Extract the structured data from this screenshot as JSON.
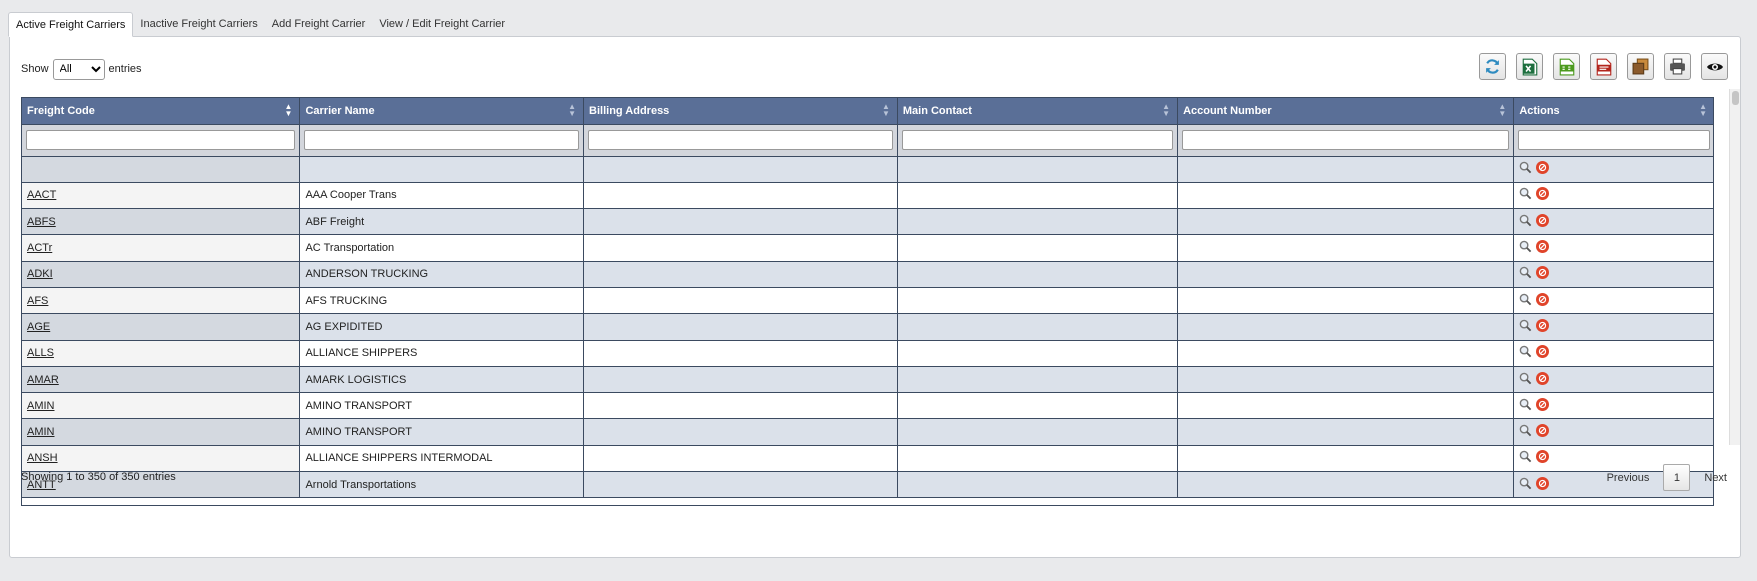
{
  "tabs": [
    {
      "label": "Active Freight Carriers"
    },
    {
      "label": "Inactive Freight Carriers"
    },
    {
      "label": "Add Freight Carrier"
    },
    {
      "label": "View / Edit Freight Carrier"
    }
  ],
  "length_control": {
    "show_label": "Show",
    "selected": "All",
    "entries_label": "entries"
  },
  "toolbar": [
    {
      "icon": "refresh-icon",
      "label": "Refresh"
    },
    {
      "icon": "excel-icon",
      "label": "Excel"
    },
    {
      "icon": "csv-icon",
      "label": "CSV"
    },
    {
      "icon": "pdf-icon",
      "label": "PDF"
    },
    {
      "icon": "copy-icon",
      "label": "Copy"
    },
    {
      "icon": "print-icon",
      "label": "Print"
    },
    {
      "icon": "eye-icon",
      "label": "Column Visibility"
    }
  ],
  "table": {
    "columns": [
      "Freight Code",
      "Carrier Name",
      "Billing Address",
      "Main Contact",
      "Account Number",
      "Actions"
    ],
    "rows": [
      {
        "code": "",
        "name": ""
      },
      {
        "code": "AACT",
        "name": "AAA Cooper Trans"
      },
      {
        "code": "ABFS",
        "name": "ABF Freight"
      },
      {
        "code": "ACTr",
        "name": "AC Transportation"
      },
      {
        "code": "ADKI",
        "name": "ANDERSON TRUCKING"
      },
      {
        "code": "AFS",
        "name": "AFS TRUCKING"
      },
      {
        "code": "AGE",
        "name": "AG EXPIDITED"
      },
      {
        "code": "ALLS",
        "name": "ALLIANCE SHIPPERS"
      },
      {
        "code": "AMAR",
        "name": "AMARK LOGISTICS"
      },
      {
        "code": "AMIN",
        "name": "AMINO TRANSPORT"
      },
      {
        "code": "AMIN",
        "name": "AMINO TRANSPORT"
      },
      {
        "code": "ANSH",
        "name": "ALLIANCE SHIPPERS INTERMODAL"
      },
      {
        "code": "ANTT",
        "name": "Arnold Transportations"
      }
    ]
  },
  "info": "Showing 1 to 350 of 350 entries",
  "pagination": {
    "previous": "Previous",
    "current": "1",
    "next": "Next"
  },
  "colors": {
    "header": "#5a6f97",
    "stripe": "#dbe1ea",
    "delete": "#e0442a"
  }
}
